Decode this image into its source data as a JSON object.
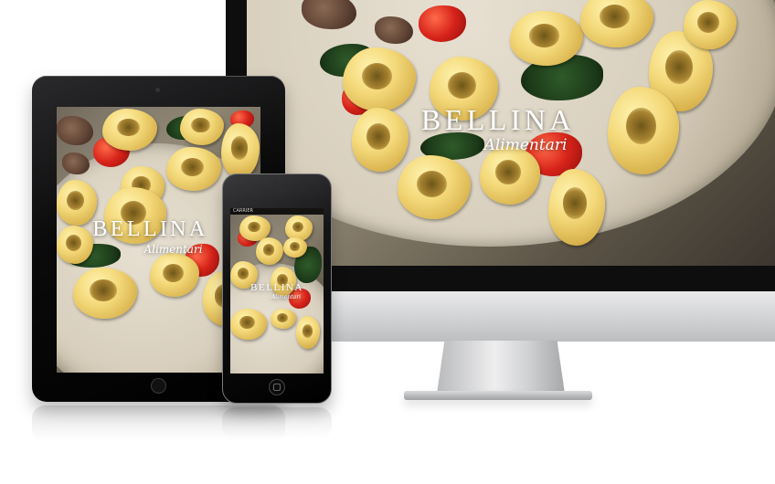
{
  "brand": {
    "name": "BELLINA",
    "subtitle": "Alimentari"
  },
  "iphone": {
    "carrier": "CARRIER"
  },
  "colors": {
    "device_black": "#0e0e0e",
    "imac_silver": "#d2d3d5",
    "pasta_yellow": "#f4d97a",
    "tomato_red": "#d7231a",
    "herb_green": "#2f5a2a",
    "plate_cream": "#e7e0d2"
  }
}
